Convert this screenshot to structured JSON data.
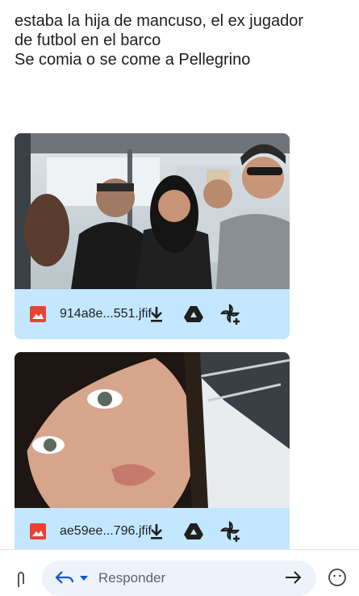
{
  "message": {
    "lines": [
      "estaba la hija de mancuso, el ex jugador",
      "de futbol en el barco",
      "Se comia o se come a Pellegrino"
    ]
  },
  "attachments": [
    {
      "filename": "914a8e...551.jfif",
      "icon": "image-icon"
    },
    {
      "filename": "ae59ee...796.jfif",
      "icon": "image-icon"
    }
  ],
  "actions": [
    "download-icon",
    "drive-icon",
    "add-to-photos-icon"
  ],
  "composer": {
    "reply_placeholder": "Responder",
    "icons": [
      "attach-icon",
      "reply-icon",
      "dropdown-caret-icon",
      "forward-icon",
      "emoji-icon"
    ]
  },
  "colors": {
    "attachment_bg": "#c2e7ff",
    "image_icon": "#e94235",
    "text": "#1f1f1f"
  }
}
